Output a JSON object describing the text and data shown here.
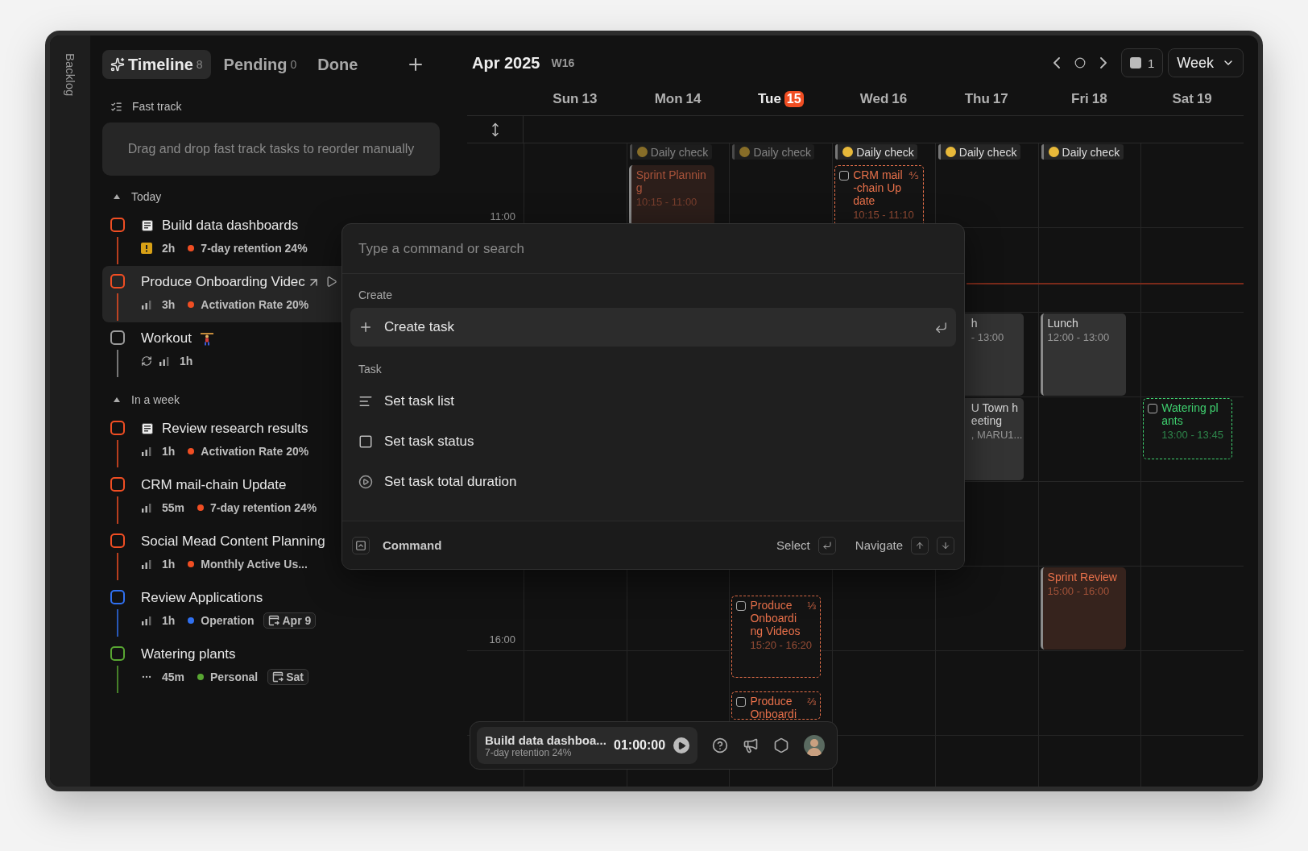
{
  "sidebar": {
    "label": "Backlog"
  },
  "tabs": [
    {
      "label": "Timeline",
      "count": "8",
      "selected": true
    },
    {
      "label": "Pending",
      "count": "0",
      "selected": false
    },
    {
      "label": "Done",
      "selected": false
    }
  ],
  "fast_track": {
    "title": "Fast track",
    "hint": "Drag and drop fast track tasks to reorder manually"
  },
  "sections": [
    {
      "title": "Today",
      "expanded": true,
      "tasks": [
        {
          "title": "Build data dashboards",
          "color": "#f04e23",
          "selected": false,
          "meta": {
            "duration": "2h",
            "goal": {
              "label": "7-day retention 24%",
              "color": "#f04e23"
            }
          }
        },
        {
          "title": "Produce Onboarding Videc",
          "color": "#f04e23",
          "selected": true,
          "meta": {
            "duration": "3h",
            "goal": {
              "label": "Activation Rate 20%",
              "color": "#f04e23"
            }
          }
        },
        {
          "title": "Workout",
          "color": "#9a9a9a",
          "selected": false,
          "meta": {
            "duration": "1h"
          }
        }
      ]
    },
    {
      "title": "In a week",
      "expanded": true,
      "tasks": [
        {
          "title": "Review research results",
          "color": "#f04e23",
          "selected": false,
          "meta": {
            "duration": "1h",
            "goal": {
              "label": "Activation Rate 20%",
              "color": "#f04e23"
            }
          }
        },
        {
          "title": "CRM mail-chain Update",
          "color": "#f04e23",
          "selected": false,
          "meta": {
            "duration": "55m",
            "goal": {
              "label": "7-day retention 24%",
              "color": "#f04e23"
            }
          }
        },
        {
          "title": "Social Mead Content Planning",
          "color": "#f04e23",
          "selected": false,
          "meta": {
            "duration": "1h",
            "goal": {
              "label": "Monthly Active Us...",
              "color": "#f04e23"
            }
          }
        },
        {
          "title": "Review Applications",
          "color": "#3070f0",
          "selected": false,
          "meta": {
            "duration": "1h",
            "goal": {
              "label": "Operation",
              "color": "#3070f0"
            },
            "tag": "Apr 9"
          }
        },
        {
          "title": "Watering plants",
          "color": "#58a632",
          "selected": false,
          "meta": {
            "duration": "45m",
            "goal": {
              "label": "Personal",
              "color": "#58a632"
            },
            "tag": "Sat"
          }
        }
      ]
    }
  ],
  "calendar": {
    "month": "Apr 2025",
    "week": "W16",
    "calendars_count": "1",
    "view": "Week",
    "hours": [
      {
        "label": "11:00"
      },
      {
        "label": "16:00"
      }
    ],
    "days": [
      {
        "weekday": "Sun",
        "date": "13",
        "today": false
      },
      {
        "weekday": "Mon",
        "date": "14",
        "today": false,
        "events": [
          {
            "kind": "chip",
            "title_lines": [
              "Daily check"
            ],
            "past": true
          },
          {
            "kind": "event",
            "title_lines": [
              "Sprint Plannin",
              "g"
            ],
            "time": "10:15 - 11:00",
            "color": "#a9533a"
          }
        ]
      },
      {
        "weekday": "Tue",
        "date": "15",
        "today": true,
        "events": [
          {
            "kind": "chip",
            "title_lines": [
              "Daily check"
            ],
            "past": true
          },
          {
            "kind": "task",
            "title_lines": [
              "Produce",
              "Onboardi",
              "ng Videos"
            ],
            "fraction": "⅓",
            "time": "15:20 - 16:20",
            "checked": false,
            "color": "#e8704a"
          },
          {
            "kind": "task",
            "title_lines": [
              "Produce",
              "Onboardi"
            ],
            "fraction": "⅔",
            "checked": false,
            "color": "#e8704a"
          }
        ]
      },
      {
        "weekday": "Wed",
        "date": "16",
        "today": false,
        "events": [
          {
            "kind": "chip",
            "title_lines": [
              "Daily check"
            ],
            "past": false
          },
          {
            "kind": "task",
            "title_lines": [
              "CRM mail",
              "-chain Up",
              "date"
            ],
            "fraction": "⅘",
            "time": "10:15 - 11:10",
            "checked": false,
            "color": "#e8704a"
          }
        ]
      },
      {
        "weekday": "Thu",
        "date": "17",
        "today": false,
        "events": [
          {
            "kind": "chip",
            "title_lines": [
              "Daily check"
            ],
            "past": false
          },
          {
            "kind": "event",
            "title_lines": [
              "h"
            ],
            "time": "- 13:00",
            "partly_hidden": true
          },
          {
            "kind": "event",
            "title_lines": [
              "U Town h",
              "eeting"
            ],
            "time": ", MARU1...",
            "partly_hidden": true
          }
        ]
      },
      {
        "weekday": "Fri",
        "date": "18",
        "today": false,
        "events": [
          {
            "kind": "chip",
            "title_lines": [
              "Daily check"
            ],
            "past": false
          },
          {
            "kind": "event",
            "title_lines": [
              "Lunch"
            ],
            "time": "12:00 - 13:00",
            "partly_hidden": false,
            "color": "#d8d8d8"
          },
          {
            "kind": "event",
            "title_lines": [
              "Sprint Review"
            ],
            "time": "15:00 - 16:00",
            "partly_hidden": false,
            "color": "#e8704a"
          }
        ]
      },
      {
        "weekday": "Sat",
        "date": "19",
        "today": false,
        "events": [
          {
            "kind": "task",
            "title_lines": [
              "Watering pl",
              "ants"
            ],
            "time": "13:00 - 13:45",
            "checked": false,
            "color": "#3ecf6e"
          }
        ]
      }
    ]
  },
  "command_palette": {
    "placeholder": "Type a command or search",
    "groups": [
      {
        "title": "Create",
        "items": [
          {
            "label": "Create task",
            "selected": true
          }
        ]
      },
      {
        "title": "Task",
        "items": [
          {
            "label": "Set task list",
            "selected": false
          },
          {
            "label": "Set task status",
            "selected": false
          },
          {
            "label": "Set task total duration",
            "selected": false
          }
        ]
      }
    ],
    "footer": {
      "label": "Command",
      "hints": [
        {
          "label": "Select"
        },
        {
          "label": "Navigate"
        }
      ]
    }
  },
  "timer": {
    "title": "Build data dashboa...",
    "subtitle": "7-day retention 24%",
    "time": "01:00:00",
    "running": false
  }
}
